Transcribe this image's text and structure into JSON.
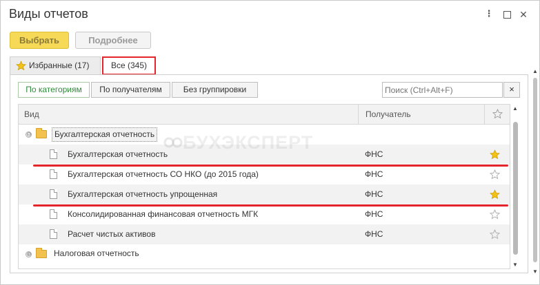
{
  "window": {
    "title": "Виды отчетов"
  },
  "toolbar": {
    "select_label": "Выбрать",
    "more_label": "Подробнее"
  },
  "tabs": [
    {
      "label": "Избранные (17)"
    },
    {
      "label": "Все (345)"
    }
  ],
  "grouping": {
    "by_category": "По категориям",
    "by_recipient": "По получателям",
    "no_grouping": "Без группировки"
  },
  "search": {
    "placeholder": "Поиск (Ctrl+Alt+F)",
    "clear_symbol": "×"
  },
  "table": {
    "columns": {
      "name": "Вид",
      "recipient": "Получатель"
    },
    "groups": [
      {
        "label": "Бухгалтерская отчетность",
        "expander": "⊖"
      },
      {
        "label": "Налоговая отчетность",
        "expander": "⊕"
      }
    ],
    "rows": [
      {
        "name": "Бухгалтерская отчетность",
        "recipient": "ФНС",
        "favorite": true
      },
      {
        "name": "Бухгалтерская отчетность СО НКО (до 2015 года)",
        "recipient": "ФНС",
        "favorite": false
      },
      {
        "name": "Бухгалтерская отчетность упрощенная",
        "recipient": "ФНС",
        "favorite": true
      },
      {
        "name": "Консолидированная финансовая отчетность МГК",
        "recipient": "ФНС",
        "favorite": false
      },
      {
        "name": "Расчет чистых активов",
        "recipient": "ФНС",
        "favorite": false
      }
    ]
  },
  "watermark": {
    "text": "БУХЭКСПЕРТ"
  },
  "colors": {
    "accent_red": "#e5232a",
    "star_gold": "#f2c218",
    "select_button": "#f5d957",
    "active_group_green": "#2f8a3a"
  },
  "icons": {
    "favorite": "star-icon",
    "folder": "folder-icon",
    "document": "document-icon"
  }
}
